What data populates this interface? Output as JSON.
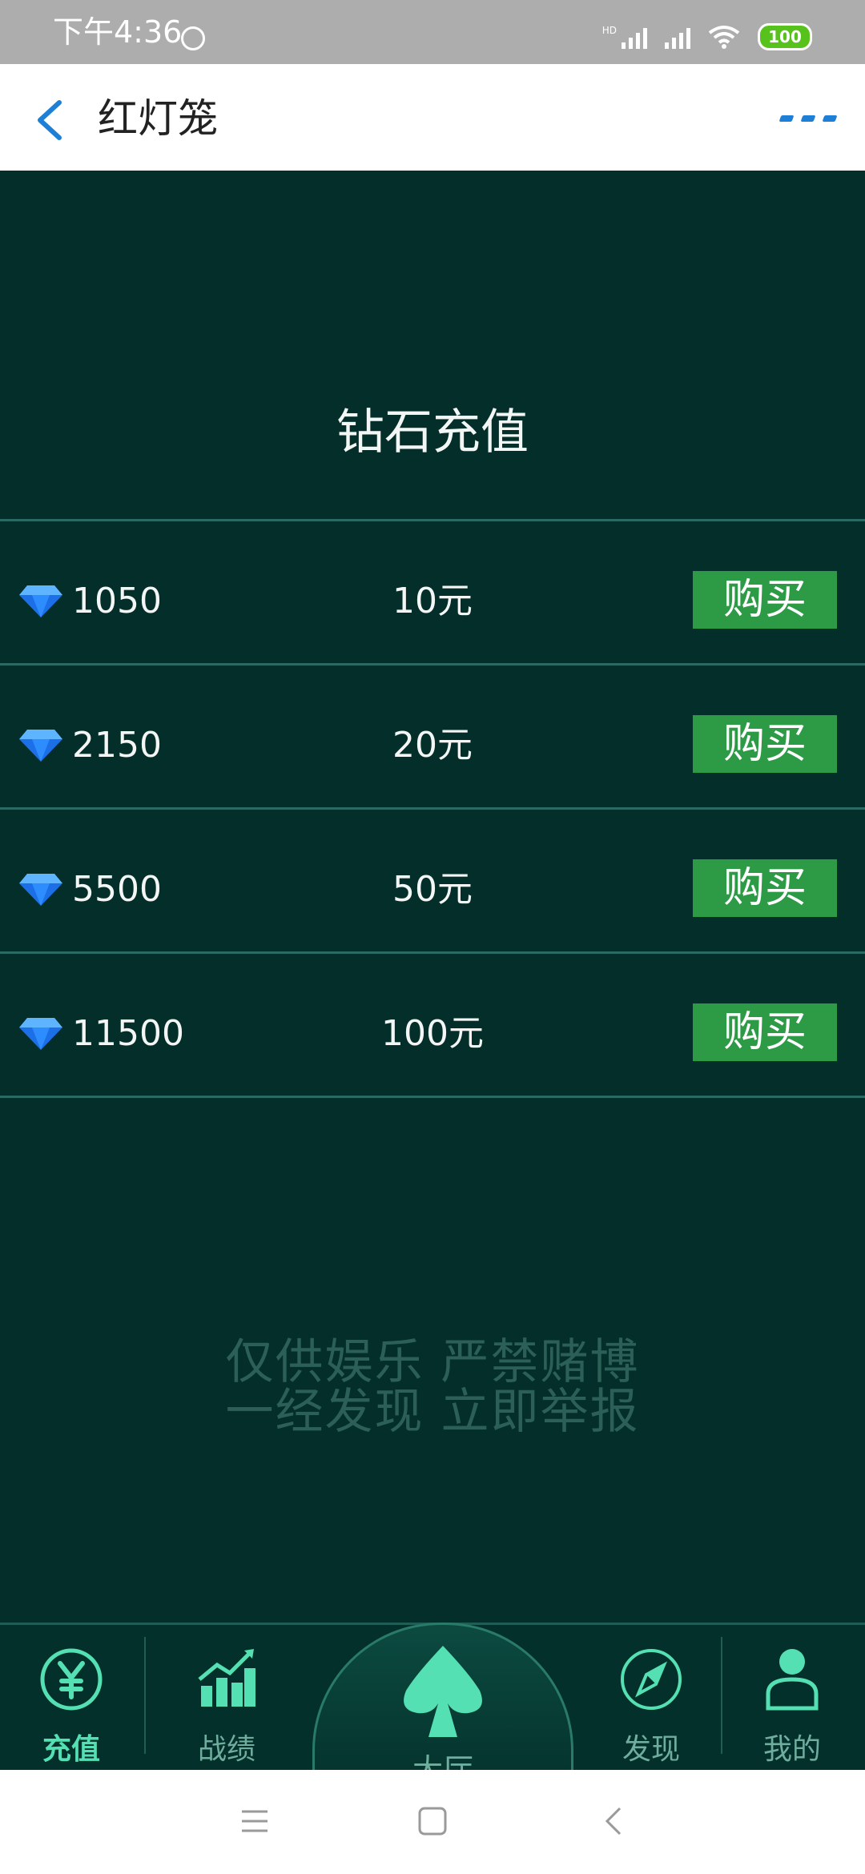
{
  "status_bar": {
    "time": "下午4:36",
    "network_label": "HD",
    "battery": "100"
  },
  "header": {
    "title": "红灯笼"
  },
  "main": {
    "title": "钻石充值",
    "packages": [
      {
        "diamonds": "1050",
        "price": "10元",
        "buy_label": "购买"
      },
      {
        "diamonds": "2150",
        "price": "20元",
        "buy_label": "购买"
      },
      {
        "diamonds": "5500",
        "price": "50元",
        "buy_label": "购买"
      },
      {
        "diamonds": "11500",
        "price": "100元",
        "buy_label": "购买"
      }
    ],
    "notice_line1": "仅供娱乐  严禁赌博",
    "notice_line2": "一经发现  立即举报"
  },
  "bottom_nav": {
    "items": [
      {
        "label": "充值",
        "icon": "yen-icon",
        "active": true
      },
      {
        "label": "战绩",
        "icon": "bar-chart-icon",
        "active": false
      },
      {
        "label": "大厅",
        "icon": "spade-icon",
        "active": false
      },
      {
        "label": "发现",
        "icon": "compass-icon",
        "active": false
      },
      {
        "label": "我的",
        "icon": "user-icon",
        "active": false
      }
    ]
  },
  "colors": {
    "background": "#042e29",
    "accent_green": "#2d9a46",
    "active_tab": "#54e0b3",
    "header_back": "#1e7fd6"
  }
}
